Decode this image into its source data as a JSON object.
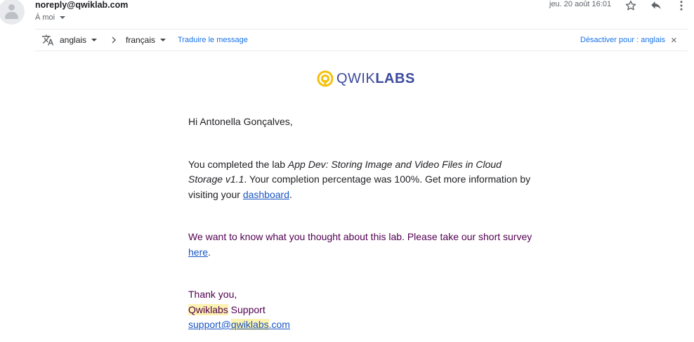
{
  "header": {
    "sender": "noreply@qwiklab.com",
    "recipient": "À moi",
    "date": "jeu. 20 août 16:01",
    "icons": [
      "star-icon",
      "reply-icon",
      "more-vert-icon"
    ]
  },
  "translate_bar": {
    "source_language": "anglais",
    "target_language": "français",
    "translate_link": "Traduire le message",
    "disable_link": "Désactiver pour : anglais",
    "close": "×"
  },
  "logo": {
    "text_light": "QWIK",
    "text_bold": "LABS",
    "colors": {
      "ring": "#f4c20d",
      "text": "#3c4a9c"
    }
  },
  "email": {
    "greeting": "Hi Antonella Gonçalves,",
    "p1_prefix": "You completed the lab ",
    "lab_name": "App Dev: Storing Image and Video Files in Cloud Storage v1.1",
    "p1_middle": ". Your completion percentage was 100%. Get more information by visiting your ",
    "dashboard_link": "dashboard",
    "p1_suffix": ".",
    "p2_prefix": "We want to know what you thought about this lab. Please take our short survey ",
    "survey_link": "here",
    "p2_suffix": ".",
    "thanks": "Thank you,",
    "sig_brand": "Qwiklabs",
    "sig_rest": " Support",
    "email_user": "support@",
    "email_brand": "qwiklabs",
    "email_tld": ".com"
  }
}
